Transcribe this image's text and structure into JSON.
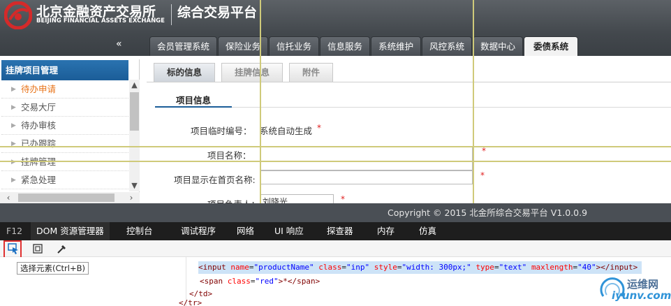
{
  "header": {
    "brand_cn": "北京金融资产交易所",
    "brand_en": "BEIJING FINANCIAL ASSETS EXCHANGE",
    "platform": "综合交易平台",
    "collapse_icon": "«",
    "nav_tabs": [
      "会员管理系统",
      "保险业务",
      "信托业务",
      "信息服务",
      "系统维护",
      "风控系统",
      "数据中心",
      "委债系统"
    ],
    "active_tab": "委债系统"
  },
  "sidebar": {
    "title": "挂牌项目管理",
    "items": [
      "待办申请",
      "交易大厅",
      "待办审核",
      "已办跟踪",
      "挂牌管理",
      "紧急处理"
    ],
    "active_item": "待办申请"
  },
  "main": {
    "subtabs": [
      "标的信息",
      "挂牌信息",
      "附件"
    ],
    "active_subtab": "标的信息",
    "section_title": "项目信息",
    "fields": {
      "temp_no_label": "项目临时编号：",
      "temp_no_value": "系统自动生成",
      "name_label": "项目名称：",
      "display_name_label": "项目显示在首页名称:",
      "owner_label": "项目负责人：",
      "owner_value": "刘晓光",
      "required_mark": "*"
    }
  },
  "footer": {
    "copyright": "Copyright © 2015 北金所综合交易平台 V1.0.0.9"
  },
  "devtools": {
    "tabs": [
      "F12",
      "DOM 资源管理器",
      "控制台",
      "调试程序",
      "网络",
      "UI 响应",
      "探查器",
      "内存",
      "仿真"
    ],
    "active_tab": "DOM 资源管理器",
    "select_tooltip": "选择元素(Ctrl+B)",
    "code": {
      "line1": {
        "open": "<input",
        "a1": "name",
        "v1": "\"productName\"",
        "a2": "class",
        "v2": "\"inp\"",
        "a3": "style",
        "v3": "\"width: 300px;\"",
        "a4": "type",
        "v4": "\"text\"",
        "a5": "maxlength",
        "v5": "\"40\"",
        "close": "></input>"
      },
      "line2": {
        "open": "<span",
        "a1": "class",
        "v1": "\"red\"",
        "text": ">*</span>"
      },
      "line3": "</td>",
      "line4": "</tr>"
    }
  },
  "watermark": {
    "cn": "运维网",
    "en": "iyunv.com"
  }
}
